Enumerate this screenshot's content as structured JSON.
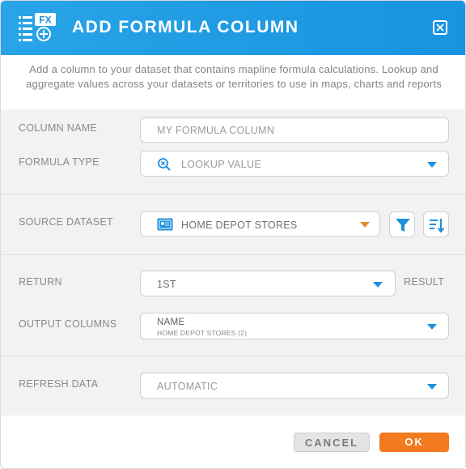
{
  "header": {
    "title": "ADD FORMULA COLUMN",
    "icon_badge": "FX",
    "accent": "#1b90dc"
  },
  "description": "Add a column to your dataset that contains mapline formula calculations. Lookup and aggregate values across your datasets or territories to use in maps, charts and reports",
  "form": {
    "column_name": {
      "label": "COLUMN NAME",
      "value": "MY FORMULA COLUMN"
    },
    "formula_type": {
      "label": "FORMULA TYPE",
      "value": "LOOKUP VALUE",
      "icon": "search-x-icon"
    },
    "source_dataset": {
      "label": "SOURCE DATASET",
      "value": "HOME DEPOT STORES",
      "icon": "dataset-icon"
    },
    "return": {
      "label": "RETURN",
      "value": "1ST",
      "suffix": "RESULT"
    },
    "output_columns": {
      "label": "OUTPUT COLUMNS",
      "value": "NAME",
      "sub_value": "HOME DEPOT STORES (2)"
    },
    "refresh_data": {
      "label": "REFRESH DATA",
      "value": "AUTOMATIC"
    }
  },
  "footer": {
    "cancel_label": "CANCEL",
    "ok_label": "OK",
    "ok_color": "#f47a1f"
  }
}
